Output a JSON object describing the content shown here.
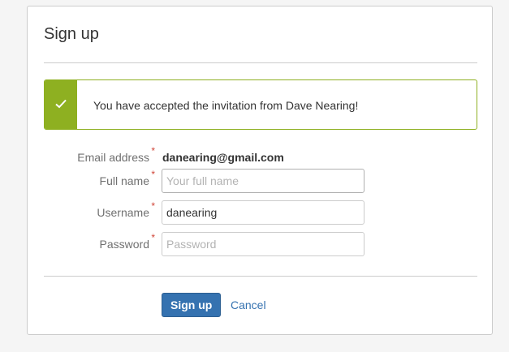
{
  "page": {
    "title": "Sign up"
  },
  "alert": {
    "icon": "checkmark-icon",
    "message": "You have accepted the invitation from Dave Nearing!",
    "color": "#8eb021"
  },
  "form": {
    "required_marker": "*",
    "email": {
      "label": "Email address",
      "value": "danearing@gmail.com"
    },
    "full_name": {
      "label": "Full name",
      "value": "",
      "placeholder": "Your full name"
    },
    "username": {
      "label": "Username",
      "value": "danearing",
      "placeholder": ""
    },
    "password": {
      "label": "Password",
      "value": "",
      "placeholder": "Password"
    }
  },
  "actions": {
    "submit_label": "Sign up",
    "cancel_label": "Cancel",
    "primary_color": "#3572b0"
  }
}
